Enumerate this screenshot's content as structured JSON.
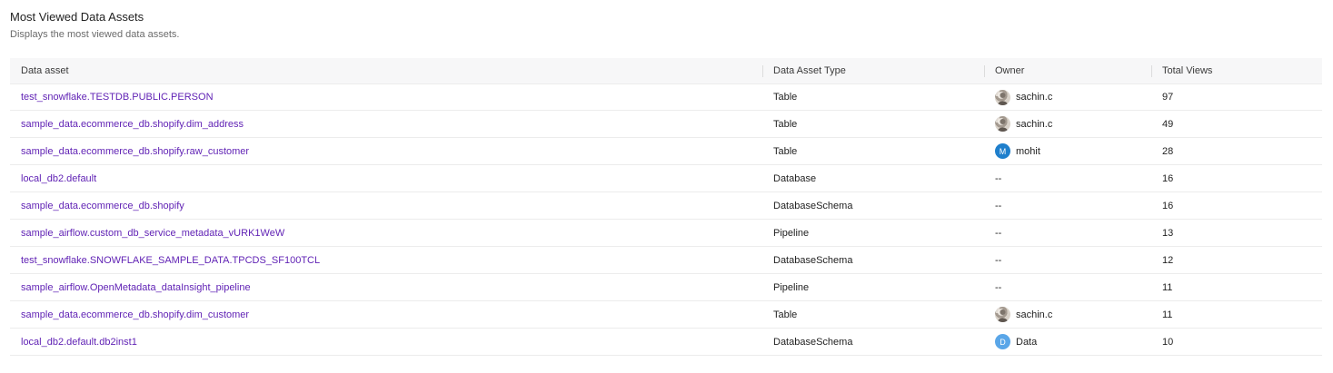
{
  "header": {
    "title": "Most Viewed Data Assets",
    "subtitle": "Displays the most viewed data assets."
  },
  "table": {
    "columns": [
      "Data asset",
      "Data Asset Type",
      "Owner",
      "Total Views"
    ],
    "rows": [
      {
        "asset": "test_snowflake.TESTDB.PUBLIC.PERSON",
        "type": "Table",
        "owner": "sachin.c",
        "owner_avatar": "photo",
        "views": "97"
      },
      {
        "asset": "sample_data.ecommerce_db.shopify.dim_address",
        "type": "Table",
        "owner": "sachin.c",
        "owner_avatar": "photo",
        "views": "49"
      },
      {
        "asset": "sample_data.ecommerce_db.shopify.raw_customer",
        "type": "Table",
        "owner": "mohit",
        "owner_avatar": "letter",
        "owner_initial": "M",
        "owner_color": "#1f7fcc",
        "views": "28"
      },
      {
        "asset": "local_db2.default",
        "type": "Database",
        "owner": "--",
        "owner_avatar": "none",
        "views": "16"
      },
      {
        "asset": "sample_data.ecommerce_db.shopify",
        "type": "DatabaseSchema",
        "owner": "--",
        "owner_avatar": "none",
        "views": "16"
      },
      {
        "asset": "sample_airflow.custom_db_service_metadata_vURK1WeW",
        "type": "Pipeline",
        "owner": "--",
        "owner_avatar": "none",
        "views": "13"
      },
      {
        "asset": "test_snowflake.SNOWFLAKE_SAMPLE_DATA.TPCDS_SF100TCL",
        "type": "DatabaseSchema",
        "owner": "--",
        "owner_avatar": "none",
        "views": "12"
      },
      {
        "asset": "sample_airflow.OpenMetadata_dataInsight_pipeline",
        "type": "Pipeline",
        "owner": "--",
        "owner_avatar": "none",
        "views": "11"
      },
      {
        "asset": "sample_data.ecommerce_db.shopify.dim_customer",
        "type": "Table",
        "owner": "sachin.c",
        "owner_avatar": "photo",
        "views": "11"
      },
      {
        "asset": "local_db2.default.db2inst1",
        "type": "DatabaseSchema",
        "owner": "Data",
        "owner_avatar": "letter",
        "owner_initial": "D",
        "owner_color": "#5aa6e8",
        "views": "10"
      }
    ]
  },
  "colors": {
    "link": "#6123b5",
    "header_bg": "#f7f7f8"
  }
}
